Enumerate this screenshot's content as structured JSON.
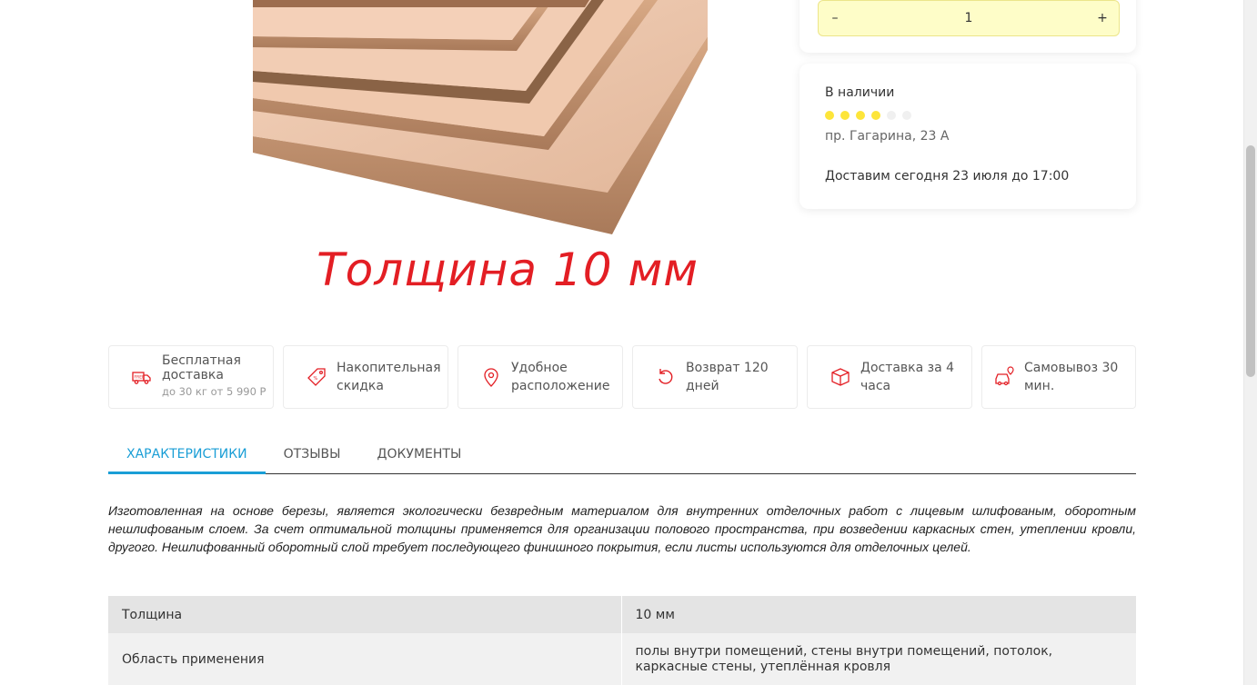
{
  "product_image": {
    "caption": "Толщина 10 мм"
  },
  "quantity": {
    "minus_label": "–",
    "value": "1",
    "plus_label": "+"
  },
  "stock": {
    "title": "В наличии",
    "rating": 4,
    "rating_max": 6,
    "address": "пр. Гагарина, 23 А",
    "delivery": "Доставим сегодня 23 июля до 17:00",
    "colors": {
      "dot_on": "#fde53a",
      "dot_off": "#f0f0f0"
    }
  },
  "features": [
    {
      "label": "Бесплатная доставка",
      "sub": "до 30 кг от 5 990 Р",
      "icon": "free-delivery-truck-icon"
    },
    {
      "label": "Накопительная скидка",
      "icon": "discount-tag-icon"
    },
    {
      "label": "Удобное расположение",
      "icon": "location-pin-icon"
    },
    {
      "label": "Возврат 120 дней",
      "icon": "return-arrow-icon"
    },
    {
      "label": "Доставка за 4 часа",
      "icon": "box-icon"
    },
    {
      "label": "Самовывоз 30 мин.",
      "icon": "car-pickup-icon"
    }
  ],
  "feature_icon_color": "#e31e24",
  "tabs": [
    {
      "label": "ХАРАКТЕРИСТИКИ",
      "active": true
    },
    {
      "label": "ОТЗЫВЫ",
      "active": false
    },
    {
      "label": "ДОКУМЕНТЫ",
      "active": false
    }
  ],
  "accent_color": "#1a9ed6",
  "description": "Изготовленная на основе березы, является экологически безвредным материалом для внутренних отделочных работ с лицевым шлифованым, оборотным нешлифованым слоем. За счет оптимальной толщины применяется для организации полового пространства, при возведении каркасных стен, утеплении кровли, другого. Нешлифованный оборотный слой требует последующего финишного покрытия, если листы используются для отделочных целей.",
  "specs": [
    {
      "key": "Толщина",
      "value": "10 мм"
    },
    {
      "key": "Область применения",
      "value": "полы внутри помещений, стены внутри помещений, потолок, каркасные стены, утеплённая кровля"
    }
  ]
}
